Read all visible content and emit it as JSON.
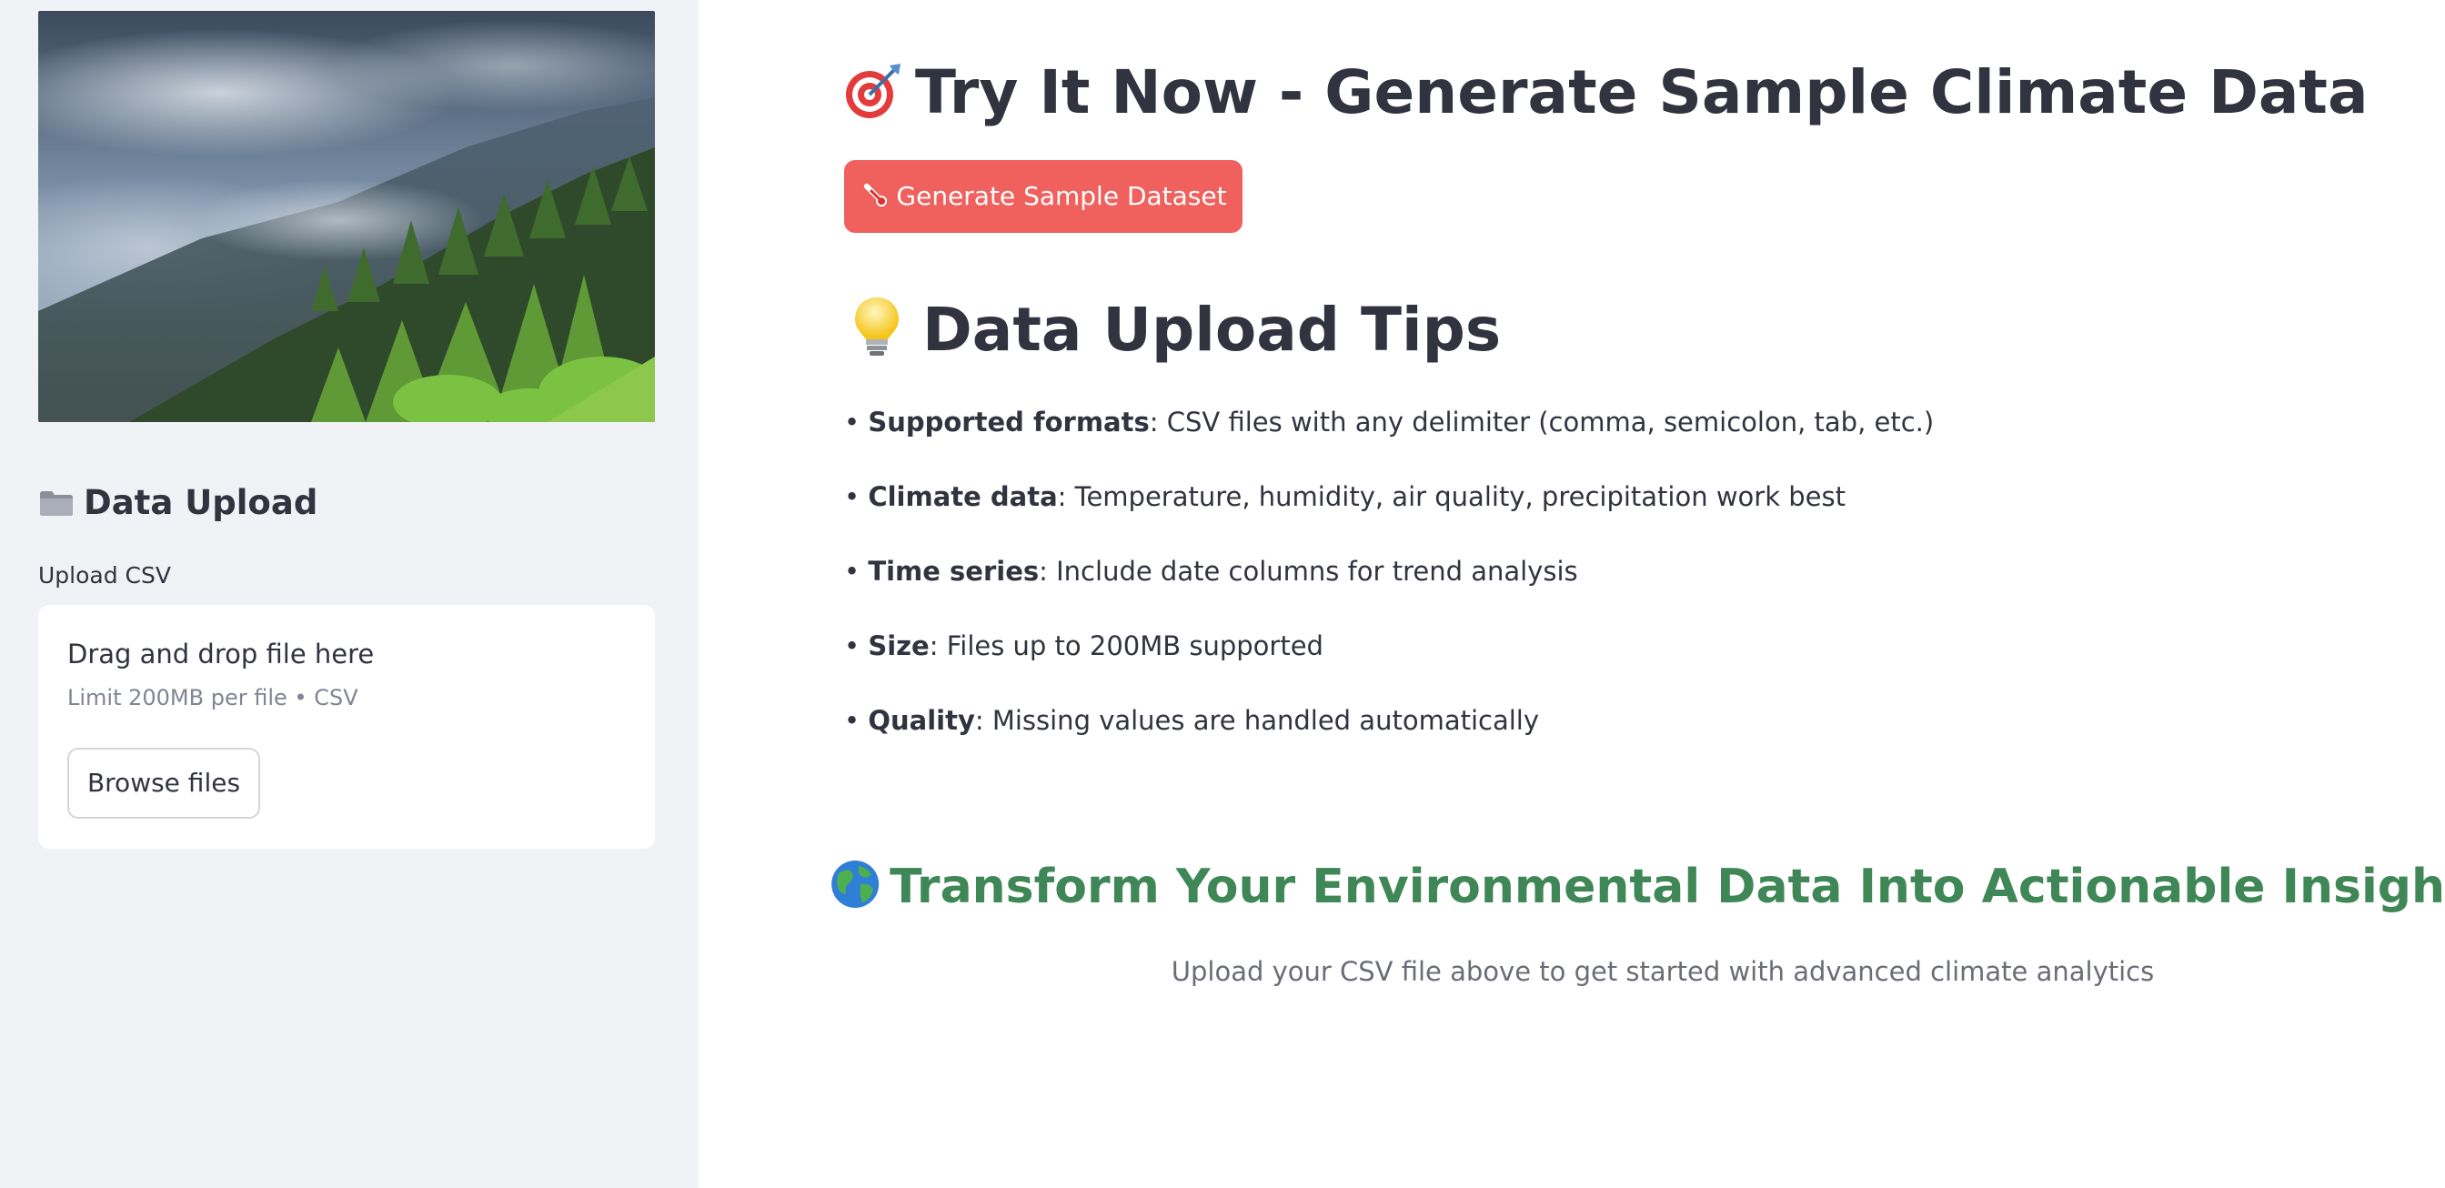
{
  "sidebar": {
    "hero_image": "misty-forest-mountain-photo",
    "header": {
      "icon": "folder-icon",
      "title": "Data Upload"
    },
    "uploader": {
      "label": "Upload CSV",
      "drop_text": "Drag and drop file here",
      "limit_text": "Limit 200MB per file • CSV",
      "browse_label": "Browse files"
    }
  },
  "main": {
    "try_section": {
      "icon": "target-icon",
      "title": "Try It Now - Generate Sample Climate Data",
      "button_icon": "thermometer-icon",
      "button_label": "Generate Sample Dataset"
    },
    "tips_section": {
      "icon": "lightbulb-icon",
      "title": "Data Upload Tips",
      "bullet": "•",
      "items": [
        {
          "label": "Supported formats",
          "text": ": CSV files with any delimiter (comma, semicolon, tab, etc.)"
        },
        {
          "label": "Climate data",
          "text": ": Temperature, humidity, air quality, precipitation work best"
        },
        {
          "label": "Time series",
          "text": ": Include date columns for trend analysis"
        },
        {
          "label": "Size",
          "text": ": Files up to 200MB supported"
        },
        {
          "label": "Quality",
          "text": ": Missing values are handled automatically"
        }
      ]
    },
    "cta": {
      "icon": "globe-icon",
      "title": "Transform Your Environmental Data Into Actionable Insights",
      "subtitle": "Upload your CSV file above to get started with advanced climate analytics"
    }
  },
  "colors": {
    "sidebar_bg": "#f0f2f6",
    "primary_button": "#f0605d",
    "cta_green": "#3f8756",
    "text": "#31333f",
    "muted": "#808495"
  }
}
